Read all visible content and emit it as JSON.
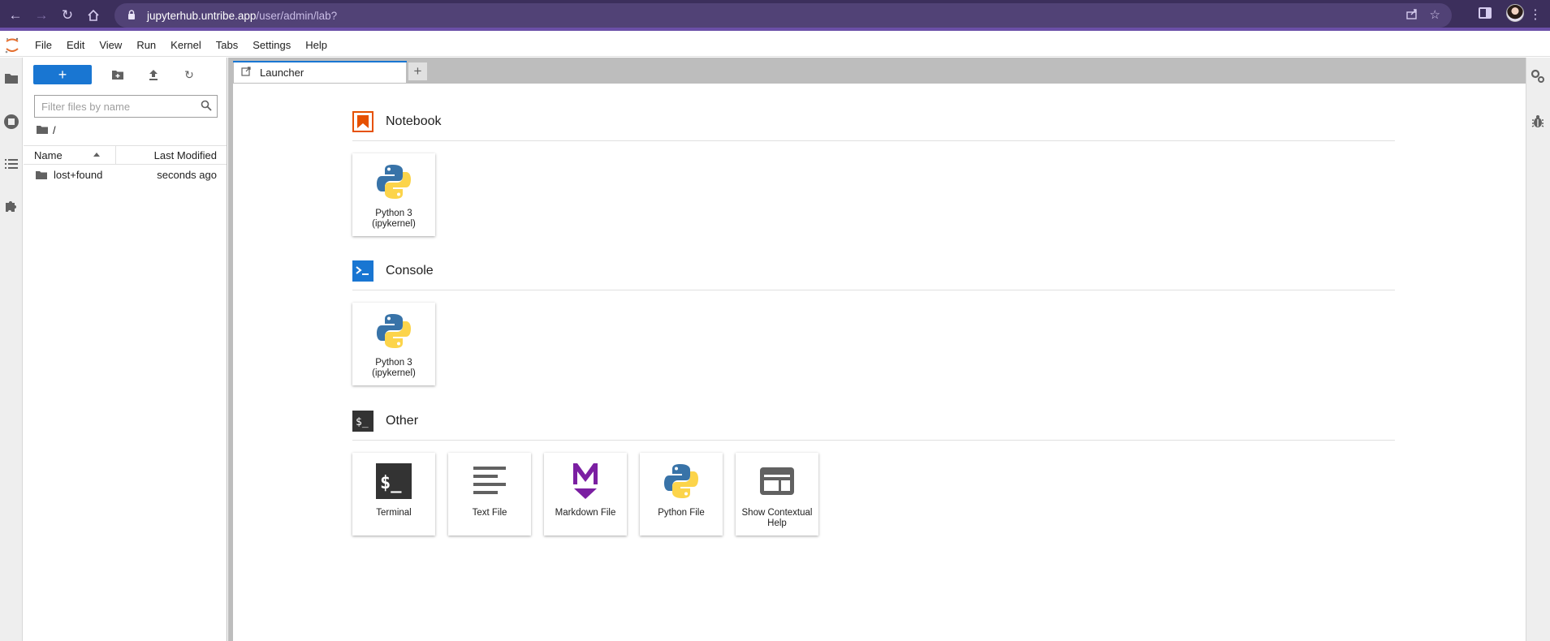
{
  "browser": {
    "url_host": "jupyterhub.untribe.app",
    "url_path": "/user/admin/lab?"
  },
  "menu": [
    "File",
    "Edit",
    "View",
    "Run",
    "Kernel",
    "Tabs",
    "Settings",
    "Help"
  ],
  "filebrowser": {
    "new_button_label": "+",
    "filter_placeholder": "Filter files by name",
    "breadcrumb": "/",
    "col_name": "Name",
    "col_modified": "Last Modified",
    "files": [
      {
        "name": "lost+found",
        "modified": "seconds ago"
      }
    ]
  },
  "tabs": {
    "active_label": "Launcher",
    "add_label": "+"
  },
  "launcher": {
    "sections": [
      {
        "title": "Notebook",
        "cards": [
          {
            "label": "Python 3 (ipykernel)"
          }
        ]
      },
      {
        "title": "Console",
        "cards": [
          {
            "label": "Python 3 (ipykernel)"
          }
        ]
      },
      {
        "title": "Other",
        "cards": [
          {
            "label": "Terminal"
          },
          {
            "label": "Text File"
          },
          {
            "label": "Markdown File"
          },
          {
            "label": "Python File"
          },
          {
            "label": "Show Contextual Help"
          }
        ]
      }
    ]
  },
  "colors": {
    "accent": "#1976d2",
    "notebook_orange": "#e65100",
    "markdown_purple": "#7b1fa2",
    "browser_bar": "#3c2f5c"
  }
}
